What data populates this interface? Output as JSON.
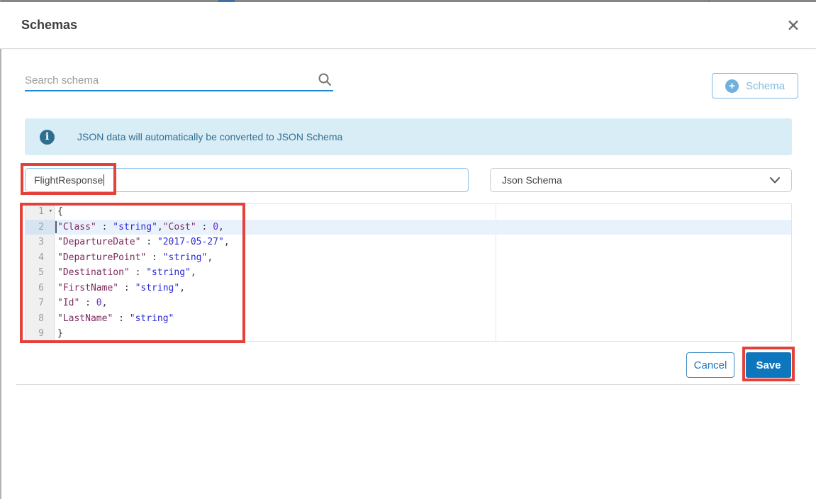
{
  "colors": {
    "annotation_red": "#e5413b",
    "accent_blue": "#0e76bc",
    "link_blue": "#1b79bb",
    "light_blue_border": "#7fbae4",
    "light_blue_text": "#85bce2",
    "plus_circle": "#6fb0dd",
    "info_bg": "#d9edf7",
    "info_fg": "#31708f",
    "info_icon_bg": "#2e6f8f",
    "search_underline": "#1d87d8",
    "input_border_blue": "#8cc1ea",
    "editor_key": "#7c2b5e",
    "editor_string": "#2a2ad6",
    "editor_number": "#6633cc",
    "editor_plain": "#333333",
    "active_line_bg": "#e9f2fc",
    "active_gutter_bg": "#d7e5f3",
    "gutter_bg": "#f0f0f0",
    "gutter_fg": "#9d9d9d"
  },
  "header": {
    "title": "Schemas",
    "close_icon": "✕"
  },
  "search": {
    "placeholder": "Search schema"
  },
  "add_schema_button": {
    "plus_icon": "+",
    "label": "Schema"
  },
  "info_banner": {
    "icon": "i",
    "text": "JSON data will automatically be converted to JSON Schema"
  },
  "schema_form": {
    "name_input": {
      "value": "FlightResponse"
    },
    "type_select": {
      "value": "Json Schema"
    }
  },
  "editor": {
    "active_line": 2,
    "fold_icon": "▾",
    "lines": [
      {
        "num": 1,
        "fold": true,
        "tokens": [
          [
            "p",
            "{"
          ]
        ]
      },
      {
        "num": 2,
        "fold": false,
        "tokens": [
          [
            "k",
            "\"Class\""
          ],
          [
            "p",
            " : "
          ],
          [
            "s",
            "\"string\""
          ],
          [
            "p",
            ","
          ],
          [
            "k",
            "\"Cost\""
          ],
          [
            "p",
            " : "
          ],
          [
            "n",
            "0"
          ],
          [
            "p",
            ","
          ]
        ]
      },
      {
        "num": 3,
        "fold": false,
        "tokens": [
          [
            "k",
            "\"DepartureDate\""
          ],
          [
            "p",
            " : "
          ],
          [
            "s",
            "\"2017-05-27\""
          ],
          [
            "p",
            ","
          ]
        ]
      },
      {
        "num": 4,
        "fold": false,
        "tokens": [
          [
            "k",
            "\"DeparturePoint\""
          ],
          [
            "p",
            " : "
          ],
          [
            "s",
            "\"string\""
          ],
          [
            "p",
            ","
          ]
        ]
      },
      {
        "num": 5,
        "fold": false,
        "tokens": [
          [
            "k",
            "\"Destination\""
          ],
          [
            "p",
            " : "
          ],
          [
            "s",
            "\"string\""
          ],
          [
            "p",
            ","
          ]
        ]
      },
      {
        "num": 6,
        "fold": false,
        "tokens": [
          [
            "k",
            "\"FirstName\""
          ],
          [
            "p",
            " : "
          ],
          [
            "s",
            "\"string\""
          ],
          [
            "p",
            ","
          ]
        ]
      },
      {
        "num": 7,
        "fold": false,
        "tokens": [
          [
            "k",
            "\"Id\""
          ],
          [
            "p",
            " : "
          ],
          [
            "n",
            "0"
          ],
          [
            "p",
            ","
          ]
        ]
      },
      {
        "num": 8,
        "fold": false,
        "tokens": [
          [
            "k",
            "\"LastName\""
          ],
          [
            "p",
            " : "
          ],
          [
            "s",
            "\"string\""
          ]
        ]
      },
      {
        "num": 9,
        "fold": false,
        "tokens": [
          [
            "p",
            "}"
          ]
        ]
      }
    ]
  },
  "footer": {
    "cancel_label": "Cancel",
    "save_label": "Save"
  }
}
